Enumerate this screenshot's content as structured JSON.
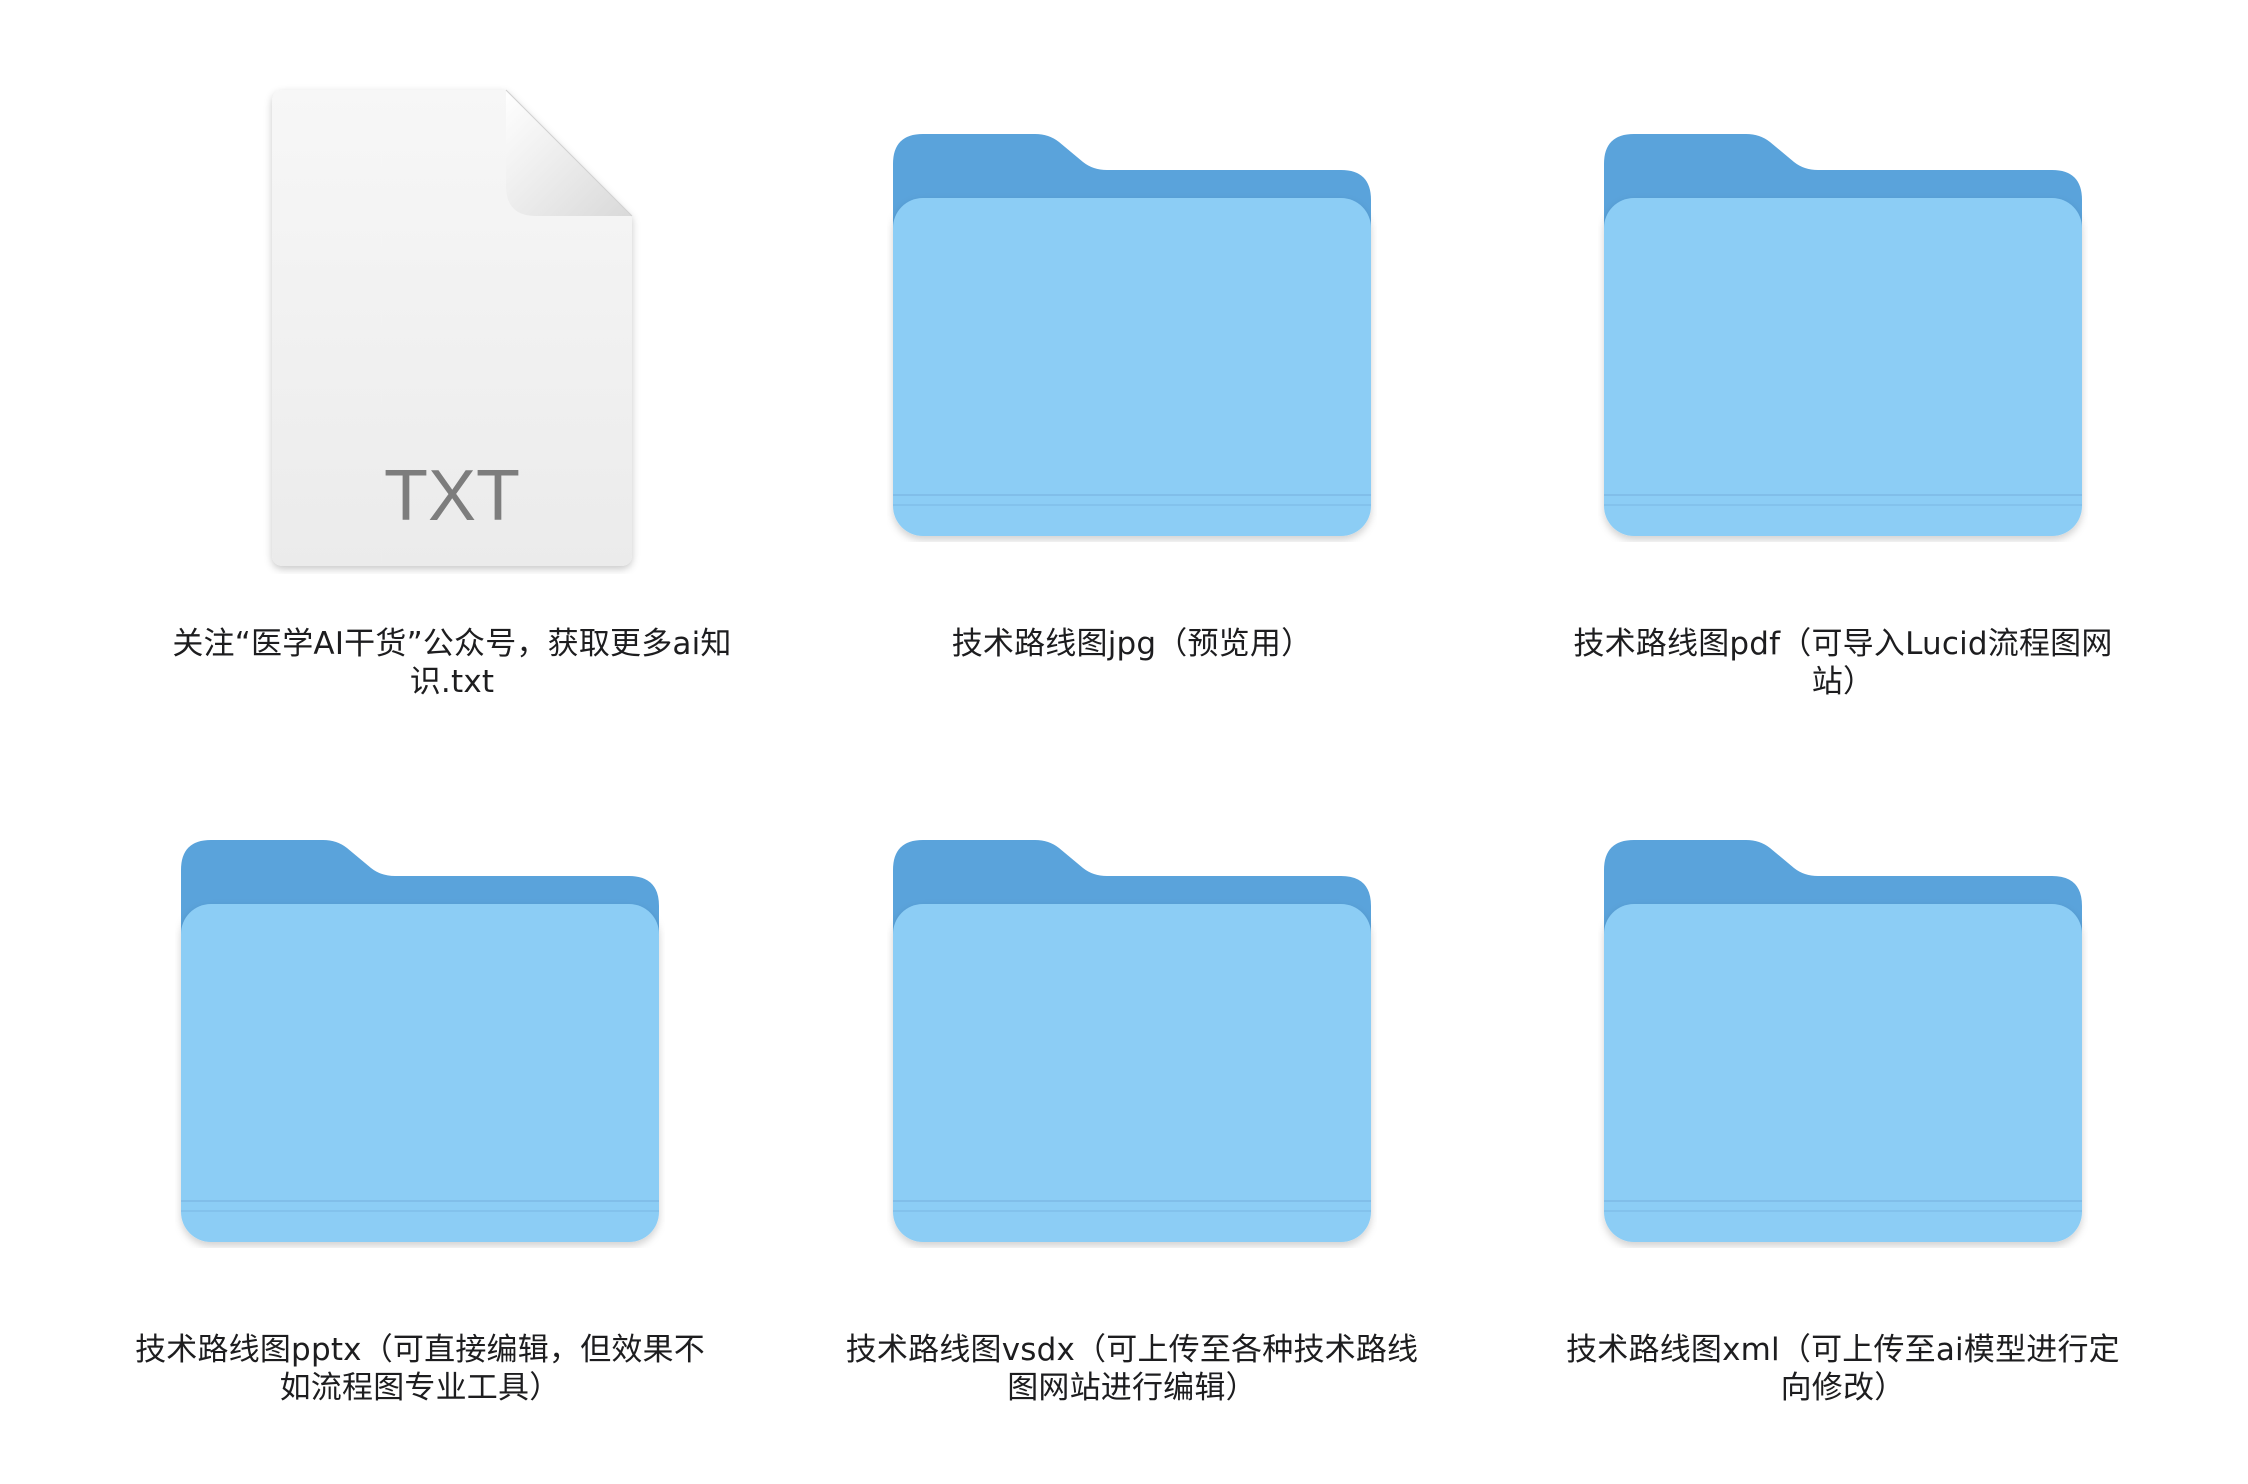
{
  "files": [
    {
      "name": "关注“医学AI干货”公众号，获取更多ai知识.txt",
      "kind": "document",
      "icon": "txt-document-icon",
      "badge": "TXT"
    },
    {
      "name": "技术路线图jpg（预览用）",
      "kind": "folder",
      "icon": "folder-icon"
    },
    {
      "name": "技术路线图pdf（可导入Lucid流程图网站）",
      "kind": "folder",
      "icon": "folder-icon"
    },
    {
      "name": "技术路线图pptx（可直接编辑，但效果不如流程图专业工具）",
      "kind": "folder",
      "icon": "folder-icon"
    },
    {
      "name": "技术路线图vsdx（可上传至各种技术路线图网站进行编辑）",
      "kind": "folder",
      "icon": "folder-icon"
    },
    {
      "name": "技术路线图xml（可上传至ai模型进行定向修改）",
      "kind": "folder",
      "icon": "folder-icon"
    }
  ],
  "colors": {
    "folder_back": "#5aa3db",
    "folder_front": "#8ccdf5",
    "doc_page": "#f2f2f2",
    "doc_badge_text": "#7d7d7d"
  }
}
